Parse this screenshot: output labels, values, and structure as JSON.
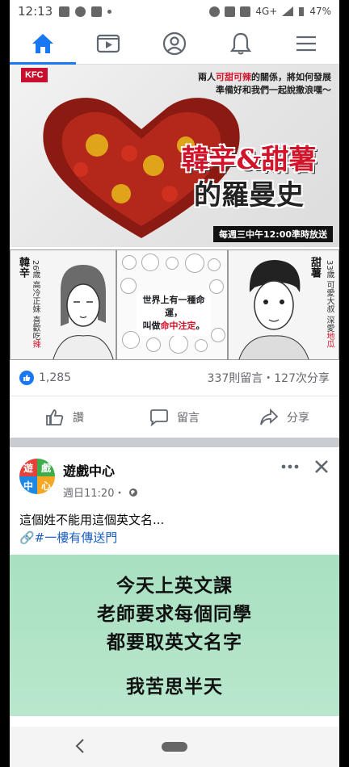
{
  "status_bar": {
    "time": "12:13",
    "network": "4G+",
    "battery": "47%"
  },
  "nav": {
    "tabs": [
      {
        "name": "home",
        "active": true
      },
      {
        "name": "watch",
        "active": false
      },
      {
        "name": "profile",
        "active": false
      },
      {
        "name": "notifications",
        "active": false
      },
      {
        "name": "menu",
        "active": false
      }
    ],
    "accent": "#1877f2"
  },
  "ad_post": {
    "brand": "KFC",
    "tagline_pre": "兩人",
    "tagline_red": "可甜可辣",
    "tagline_post": "的關係，將如何發展 準備好和我們一起說撒浪嘿～",
    "title_line1": "韓辛&甜薯",
    "title_line2": "的羅曼史",
    "schedule": "每週三中午12:00準時放送",
    "left_name": "韓辛",
    "left_desc_pre": "26歲 高冷正妹 喜歡吃",
    "left_desc_red": "辣",
    "center_line1": "世界上有一種命運，",
    "center_line2_pre": "叫做",
    "center_line2_red": "命中注定",
    "center_line2_post": "。",
    "right_name": "甜薯",
    "right_desc_pre": "33歲 可愛大叔 深愛",
    "right_desc_red": "地瓜",
    "likes": "1,285",
    "comments_shares": "337則留言・127次分享",
    "action_like": "讚",
    "action_comment": "留言",
    "action_share": "分享"
  },
  "post2": {
    "page_name": "遊戲中心",
    "avatar_chars": [
      "遊",
      "戲",
      "中",
      "心"
    ],
    "time": "週日11:20・",
    "text": "這個姓不能用這個英文名...",
    "hashtag": "🔗#一樓有傳送門",
    "image_lines": [
      "今天上英文課",
      "老師要求每個同學",
      "都要取英文名字",
      "我苦思半天"
    ]
  }
}
